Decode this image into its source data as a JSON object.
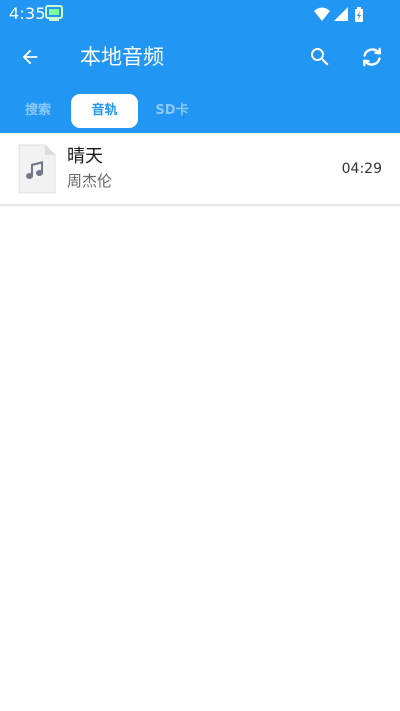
{
  "status_bar": {
    "time": "4:35",
    "notification_icon": "tv-app-icon",
    "wifi_icon": "wifi-icon",
    "signal_icon": "signal-icon",
    "battery_icon": "battery-charging-icon"
  },
  "app_bar": {
    "title": "本地音频",
    "back_icon": "arrow-back-icon",
    "search_icon": "search-icon",
    "refresh_icon": "refresh-icon"
  },
  "tabs": [
    {
      "label": "搜索",
      "active": false
    },
    {
      "label": "音轨",
      "active": true
    },
    {
      "label": "SD卡",
      "active": false
    }
  ],
  "tracks": [
    {
      "title": "晴天",
      "artist": "周杰伦",
      "duration": "04:29",
      "icon": "music-file-icon"
    }
  ],
  "colors": {
    "primary": "#2196f3",
    "tab_inactive": "#8cc8fa",
    "background": "#ffffff",
    "title_text": "#1a1a1a",
    "secondary_text": "#666666"
  }
}
